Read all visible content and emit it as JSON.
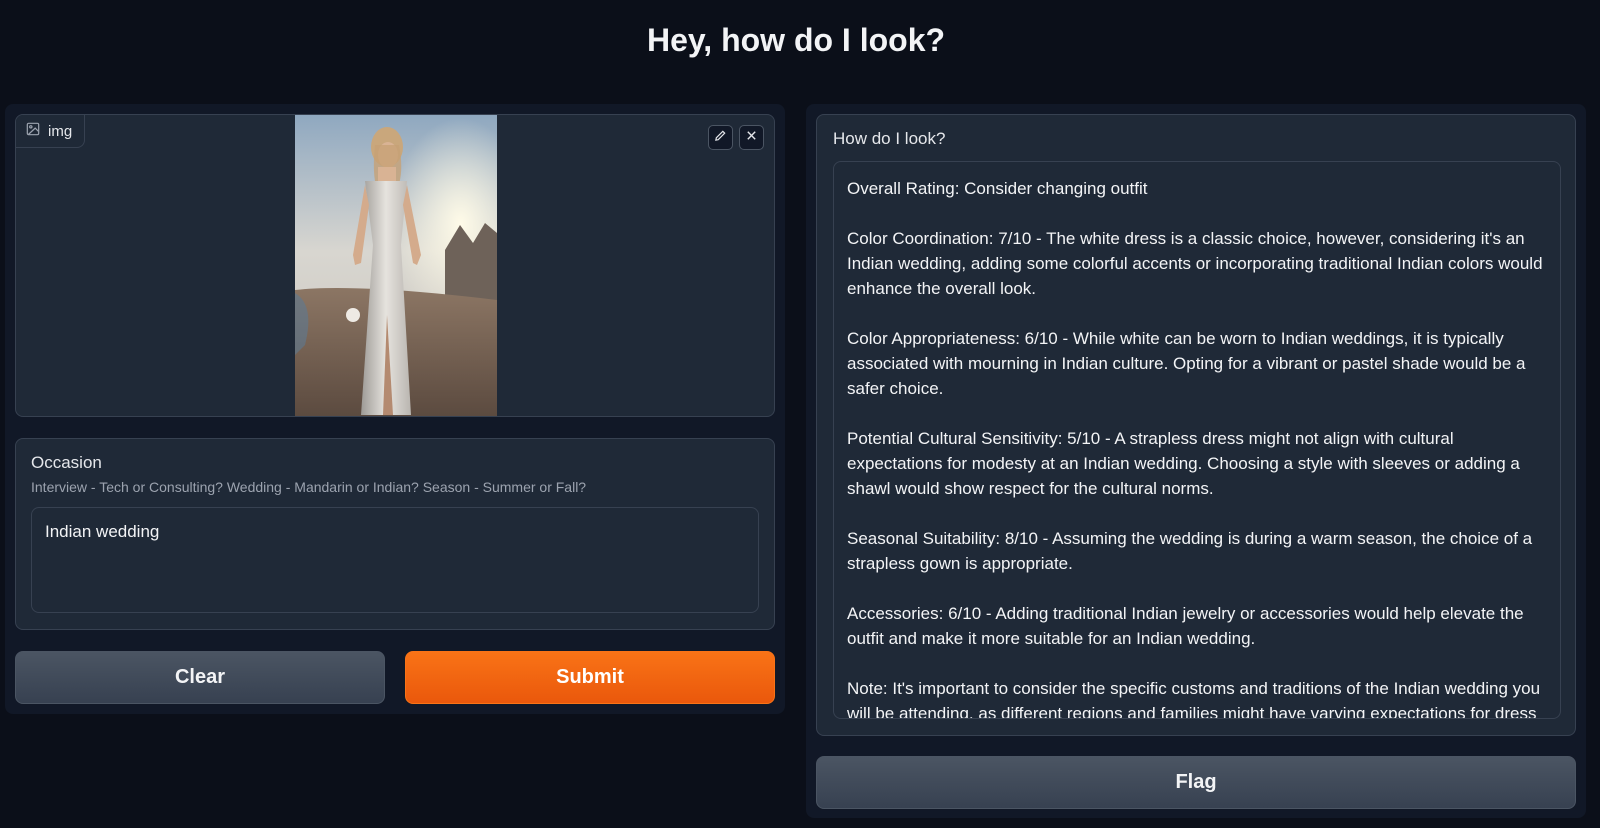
{
  "header": {
    "title": "Hey, how do I look?"
  },
  "image_input": {
    "label": "img",
    "label_icon": "image-icon",
    "edit_icon": "pencil-icon",
    "remove_icon": "close-icon"
  },
  "occasion": {
    "label": "Occasion",
    "info": "Interview - Tech or Consulting? Wedding - Mandarin or Indian? Season - Summer or Fall?",
    "value": "Indian wedding"
  },
  "buttons": {
    "clear": "Clear",
    "submit": "Submit",
    "flag": "Flag"
  },
  "output": {
    "label": "How do I look?",
    "paragraphs": [
      "Overall Rating: Consider changing outfit",
      "Color Coordination: 7/10 - The white dress is a classic choice, however, considering it's an Indian wedding, adding some colorful accents or incorporating traditional Indian colors would enhance the overall look.",
      "Color Appropriateness: 6/10 - While white can be worn to Indian weddings, it is typically associated with mourning in Indian culture. Opting for a vibrant or pastel shade would be a safer choice.",
      "Potential Cultural Sensitivity: 5/10 - A strapless dress might not align with cultural expectations for modesty at an Indian wedding. Choosing a style with sleeves or adding a shawl would show respect for the cultural norms.",
      "Seasonal Suitability: 8/10 - Assuming the wedding is during a warm season, the choice of a strapless gown is appropriate.",
      "Accessories: 6/10 - Adding traditional Indian jewelry or accessories would help elevate the outfit and make it more suitable for an Indian wedding.",
      "Note: It's important to consider the specific customs and traditions of the Indian wedding you will be attending, as different regions and families might have varying expectations for dress"
    ]
  },
  "colors": {
    "background": "#0b0f19",
    "panel": "#111827",
    "block": "#1f2937",
    "accent": "#f97316"
  }
}
